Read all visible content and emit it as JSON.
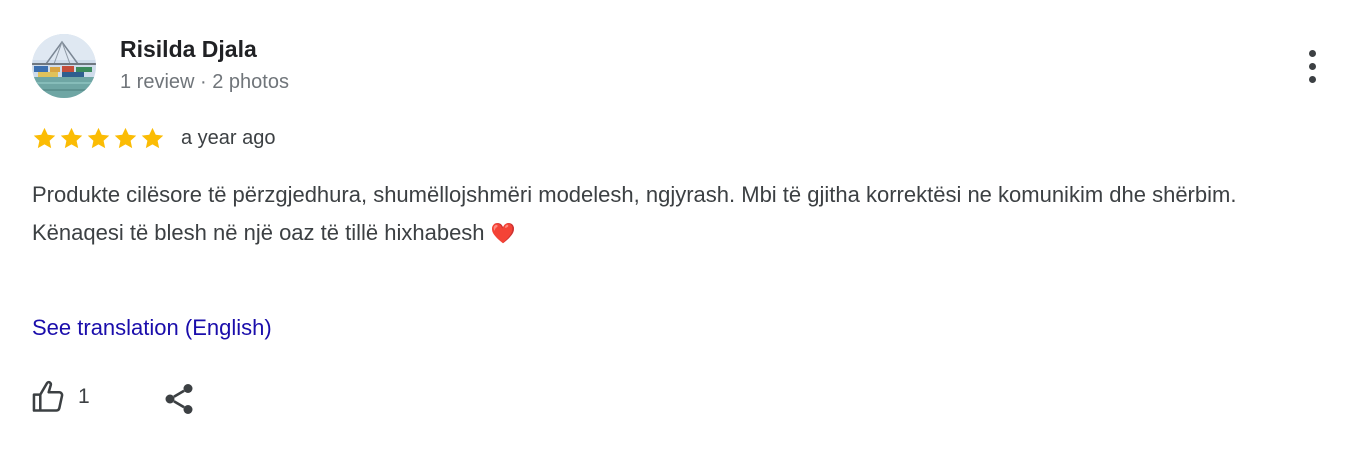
{
  "reviewer": {
    "name": "Risilda Djala",
    "meta": "1 review · 2 photos"
  },
  "rating": {
    "stars": 5,
    "max": 5,
    "color": "#fbbc04"
  },
  "review": {
    "date": "a year ago",
    "text_line1": "Produkte cilësore të përzgjedhura, shumëllojshmëri modelesh, ngjyrash. Mbi të gjitha korrektësi ne komunikim dhe shërbim.",
    "text_line2": "Kënaqesi të blesh në një oaz të tillë hixhabesh",
    "emoji": "❤️"
  },
  "actions": {
    "translate_label": "See translation (English)",
    "like_count": "1",
    "like_icon": "thumb-up-icon",
    "share_icon": "share-icon",
    "more_icon": "more-vert-icon"
  },
  "colors": {
    "link": "#1a0dab",
    "text": "#3c4043",
    "meta": "#70757a"
  }
}
